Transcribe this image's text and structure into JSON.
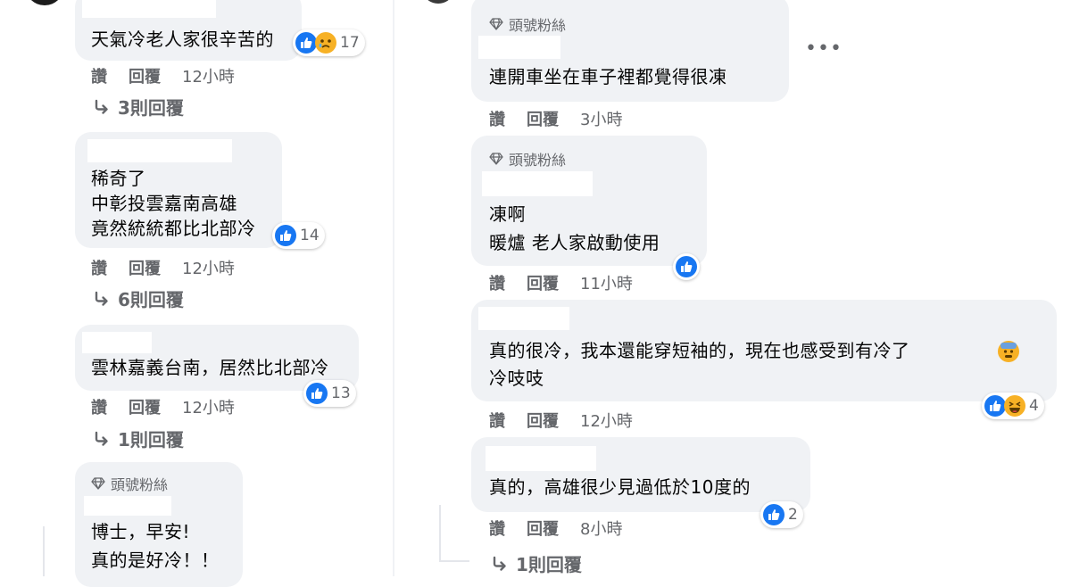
{
  "badge": "頭號粉絲",
  "actions": {
    "like": "讚",
    "reply": "回覆"
  },
  "more": "•••",
  "left": [
    {
      "text": "天氣冷老人家很辛苦的",
      "time": "12小時",
      "count": "17",
      "replies": "3則回覆"
    },
    {
      "text": "稀奇了\n中彰投雲嘉南高雄\n竟然統統都比北部冷",
      "time": "12小時",
      "count": "14",
      "replies": "6則回覆"
    },
    {
      "text": "雲林嘉義台南，居然比北部冷",
      "time": "12小時",
      "count": "13",
      "replies": "1則回覆"
    },
    {
      "text": "博士，早安!\n真的是好冷！！"
    }
  ],
  "right": [
    {
      "text": "連開車坐在車子裡都覺得很凍",
      "time": "3小時"
    },
    {
      "text": "凍啊\n暖爐 老人家啟動使用",
      "time": "11小時"
    },
    {
      "text": "真的很冷，我本還能穿短袖的，現在也感受到有冷了",
      "text2": "冷吱吱",
      "time": "12小時",
      "count": "4"
    },
    {
      "text": "真的，高雄很少見過低於10度的",
      "time": "8小時",
      "count": "2",
      "replies": "1則回覆"
    }
  ]
}
